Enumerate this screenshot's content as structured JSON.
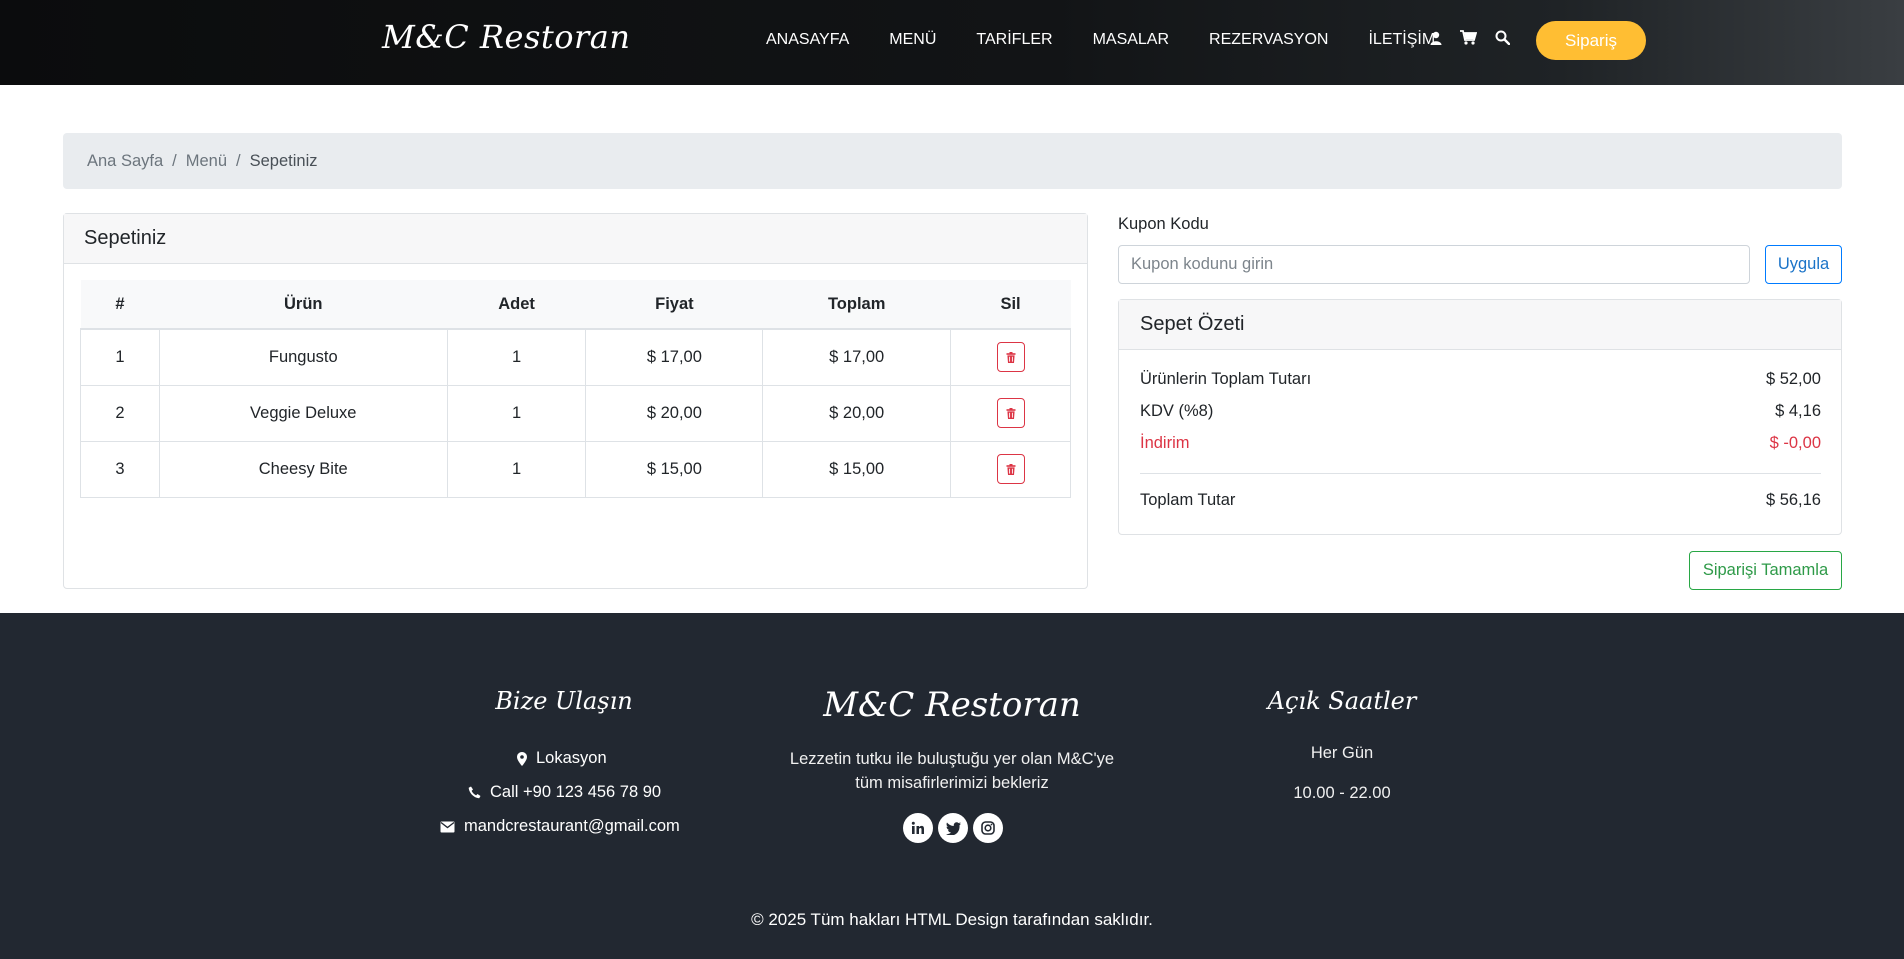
{
  "header": {
    "logo": "M&C Restoran",
    "nav": [
      "ANASAYFA",
      "MENÜ",
      "TARİFLER",
      "MASALAR",
      "REZERVASYON",
      "İLETİŞİM"
    ],
    "icons": [
      "user-icon",
      "cart-icon",
      "search-icon"
    ],
    "order_button": "Sipariş"
  },
  "breadcrumb": {
    "home": "Ana Sayfa",
    "menu": "Menü",
    "current": "Sepetiniz"
  },
  "cart": {
    "title": "Sepetiniz",
    "columns": [
      "#",
      "Ürün",
      "Adet",
      "Fiyat",
      "Toplam",
      "Sil"
    ],
    "rows": [
      {
        "no": "1",
        "product": "Fungusto",
        "qty": "1",
        "price": "$ 17,00",
        "total": "$ 17,00"
      },
      {
        "no": "2",
        "product": "Veggie Deluxe",
        "qty": "1",
        "price": "$ 20,00",
        "total": "$ 20,00"
      },
      {
        "no": "3",
        "product": "Cheesy Bite",
        "qty": "1",
        "price": "$ 15,00",
        "total": "$ 15,00"
      }
    ]
  },
  "coupon": {
    "label": "Kupon Kodu",
    "placeholder": "Kupon kodunu girin",
    "apply": "Uygula"
  },
  "summary": {
    "title": "Sepet Özeti",
    "items_total_label": "Ürünlerin Toplam Tutarı",
    "items_total": "$ 52,00",
    "vat_label": "KDV (%8)",
    "vat": "$ 4,16",
    "discount_label": "İndirim",
    "discount": "$ -0,00",
    "grand_total_label": "Toplam Tutar",
    "grand_total": "$ 56,16",
    "complete_button": "Siparişi Tamamla"
  },
  "footer": {
    "contact_title": "Bize Ulaşın",
    "location": "Lokasyon",
    "phone": "Call +90 123 456 78 90",
    "email": "mandcrestaurant@gmail.com",
    "brand": "M&C Restoran",
    "description": "Lezzetin tutku ile buluştuğu yer olan M&C'ye tüm misafirlerimizi bekleriz",
    "socials": [
      "linkedin-icon",
      "twitter-icon",
      "instagram-icon"
    ],
    "hours_title": "Açık Saatler",
    "hours_days": "Her Gün",
    "hours_time": "10.00 - 22.00",
    "copyright": "© 2025 Tüm hakları HTML Design tarafından saklıdır."
  },
  "colors": {
    "accent": "#ffbe33",
    "header_bg": "#0b0c0d",
    "footer_bg": "#222831",
    "danger": "#dc3545",
    "success": "#28a745",
    "primary": "#007bff"
  }
}
